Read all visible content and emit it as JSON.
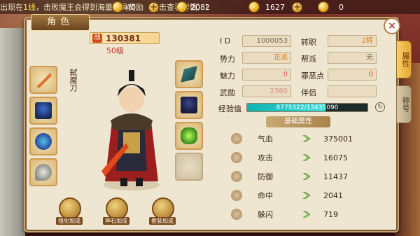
{
  "ticker": {
    "part1": "出现在",
    "line": "1线",
    "part2": "，击败魔王会得到海量道具奖励（点击查看详情）！"
  },
  "currency": [
    {
      "name": "gold-coin",
      "value": "40"
    },
    {
      "name": "ingot",
      "value": "2082"
    },
    {
      "name": "silver",
      "value": "1627"
    },
    {
      "name": "bound-silver",
      "value": "0"
    }
  ],
  "panel": {
    "title": "角色",
    "close_glyph": "×"
  },
  "tabs": [
    {
      "label": "属性",
      "active": true
    },
    {
      "label": "称号",
      "active": false
    }
  ],
  "character": {
    "power_tag": "战",
    "power": "130381",
    "level": "50级",
    "weapon_name": "弑魔刀"
  },
  "bottom_buttons": [
    {
      "label": "强化加成"
    },
    {
      "label": "神石加成"
    },
    {
      "label": "套装加成"
    }
  ],
  "info": {
    "id_label": "I D",
    "id_value": "1000053",
    "rebirth_label": "转职",
    "rebirth_value": "2转",
    "faction_label": "势力",
    "faction_value": "正派",
    "guild_label": "帮派",
    "guild_value": "无",
    "charm_label": "魅力",
    "charm_value": "0",
    "evil_label": "罪恶点",
    "evil_value": "0",
    "martial_label": "武勋",
    "martial_value": "2380",
    "partner_label": "伴侣",
    "partner_value": "",
    "exp_label": "经验值",
    "exp_text": "8775322/13435090",
    "exp_ratio": 0.653
  },
  "base_header": "基础属性",
  "stats": [
    {
      "name": "气血",
      "value": "375001"
    },
    {
      "name": "攻击",
      "value": "16075"
    },
    {
      "name": "防御",
      "value": "11437"
    },
    {
      "name": "命中",
      "value": "2041"
    },
    {
      "name": "躲闪",
      "value": "719"
    }
  ]
}
